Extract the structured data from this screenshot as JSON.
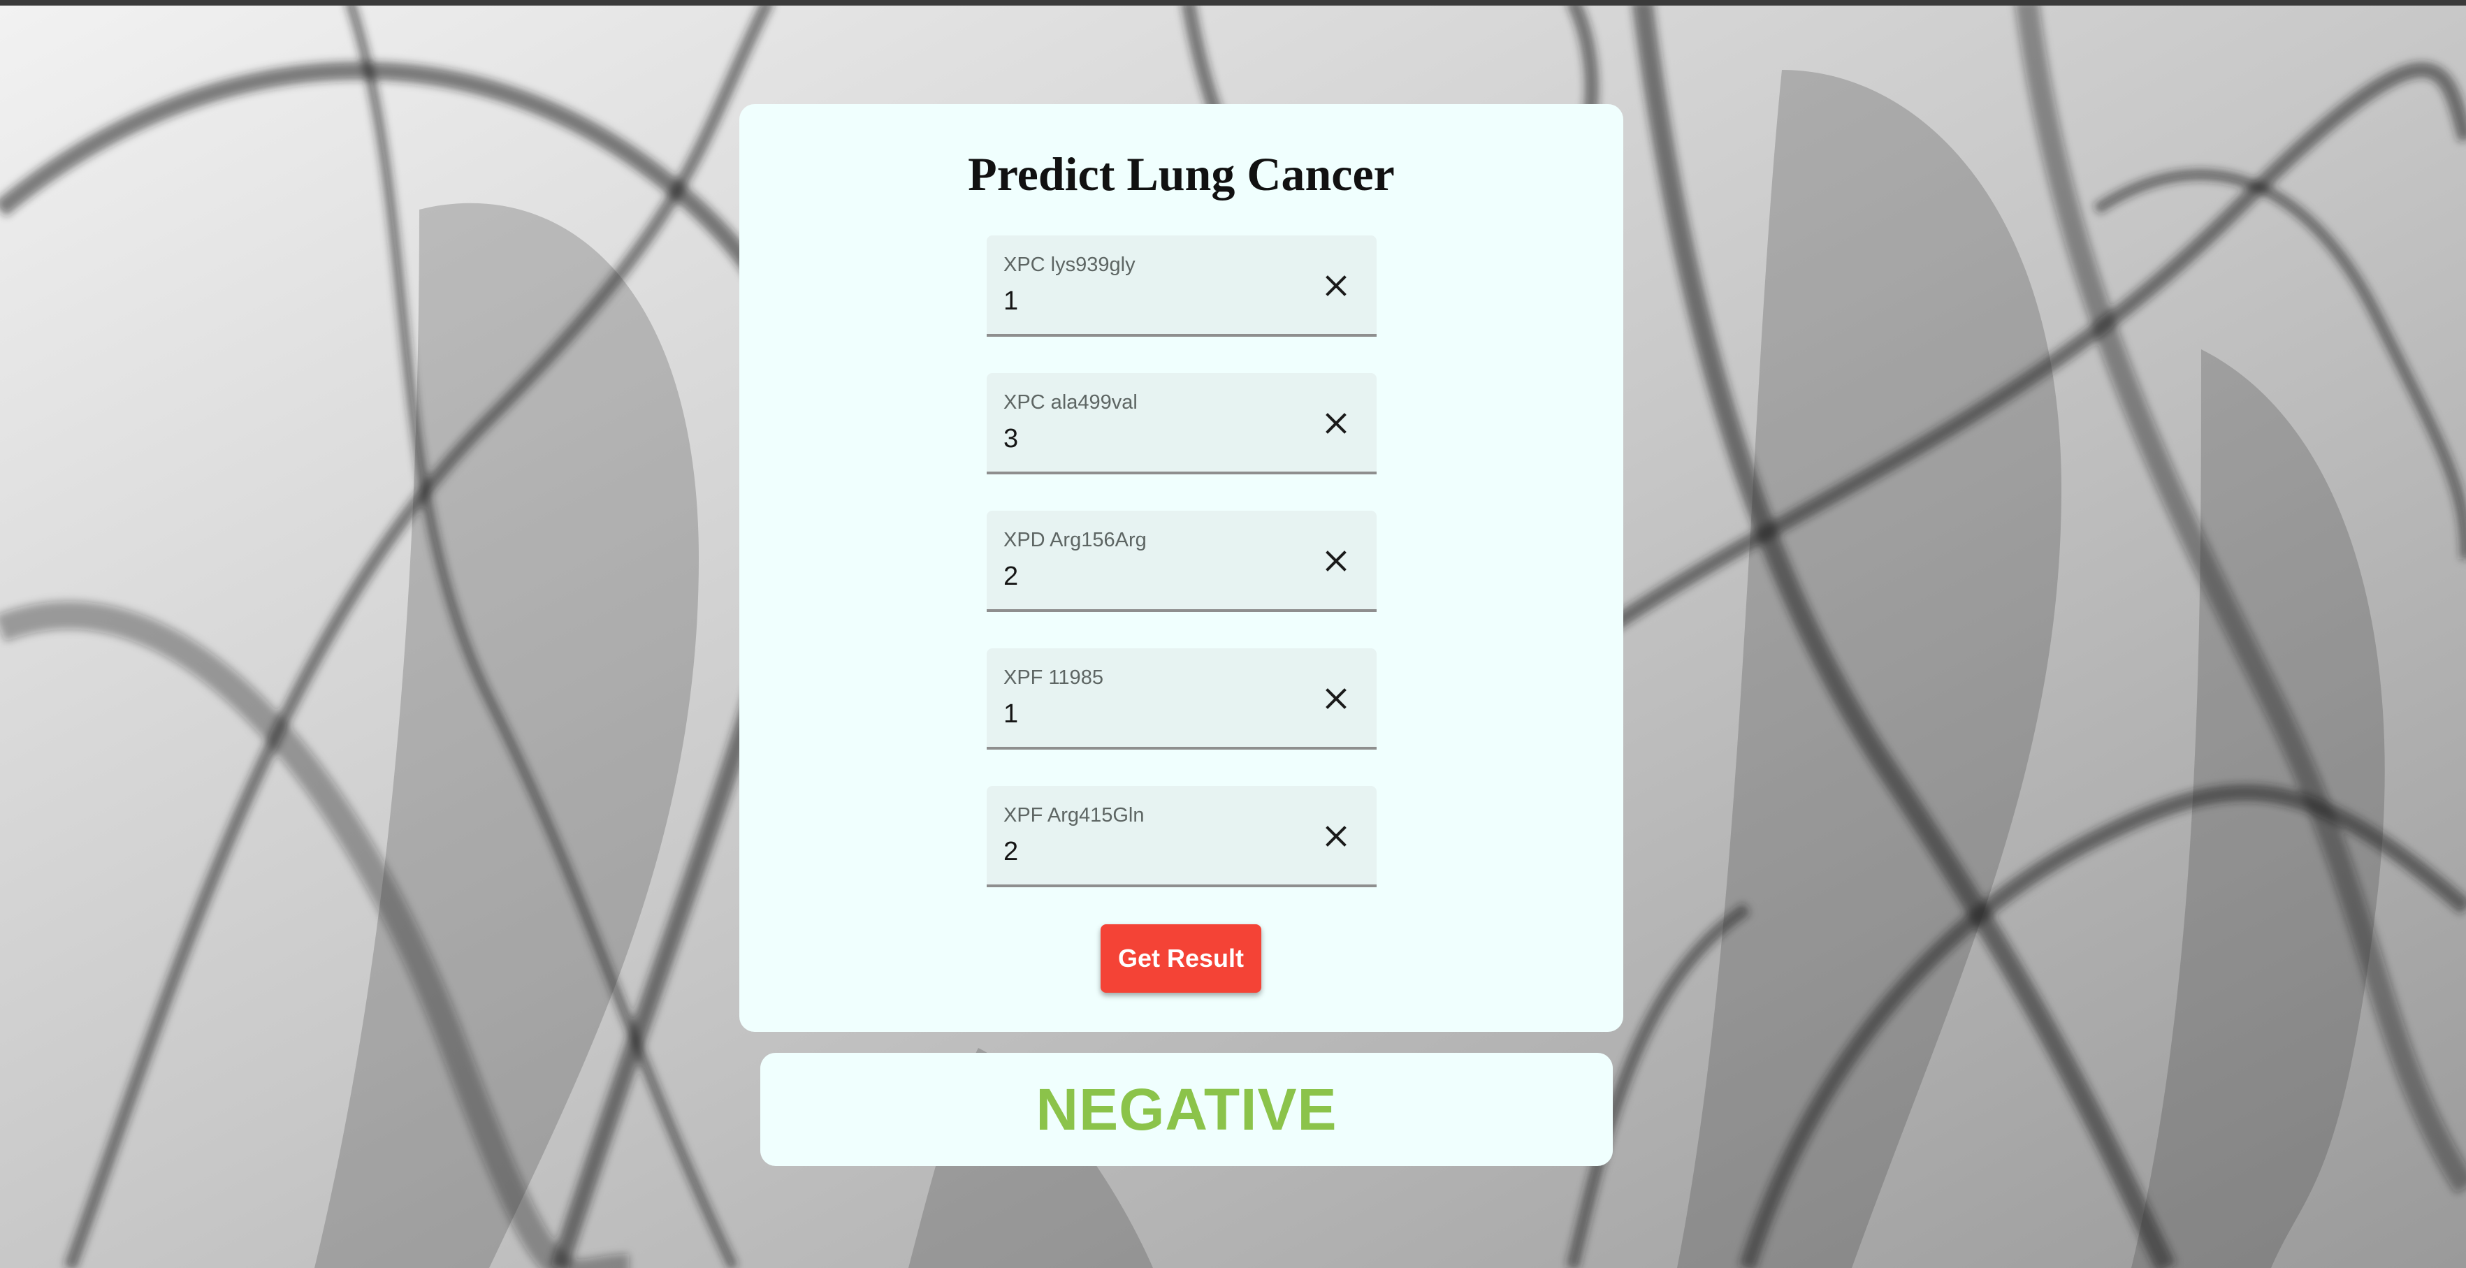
{
  "form": {
    "title": "Predict Lung Cancer",
    "fields": [
      {
        "label": "XPC lys939gly",
        "value": "1"
      },
      {
        "label": "XPC ala499val",
        "value": "3"
      },
      {
        "label": "XPD Arg156Arg",
        "value": "2"
      },
      {
        "label": "XPF 11985",
        "value": "1"
      },
      {
        "label": "XPF Arg415Gln",
        "value": "2"
      }
    ],
    "submit_label": "Get Result"
  },
  "result": {
    "text": "NEGATIVE",
    "color": "#8bc34a"
  },
  "colors": {
    "card_background": "#f0fffe",
    "field_background": "#e7f3f2",
    "button": "#f44336"
  },
  "icons": {
    "clear": "close-icon"
  }
}
